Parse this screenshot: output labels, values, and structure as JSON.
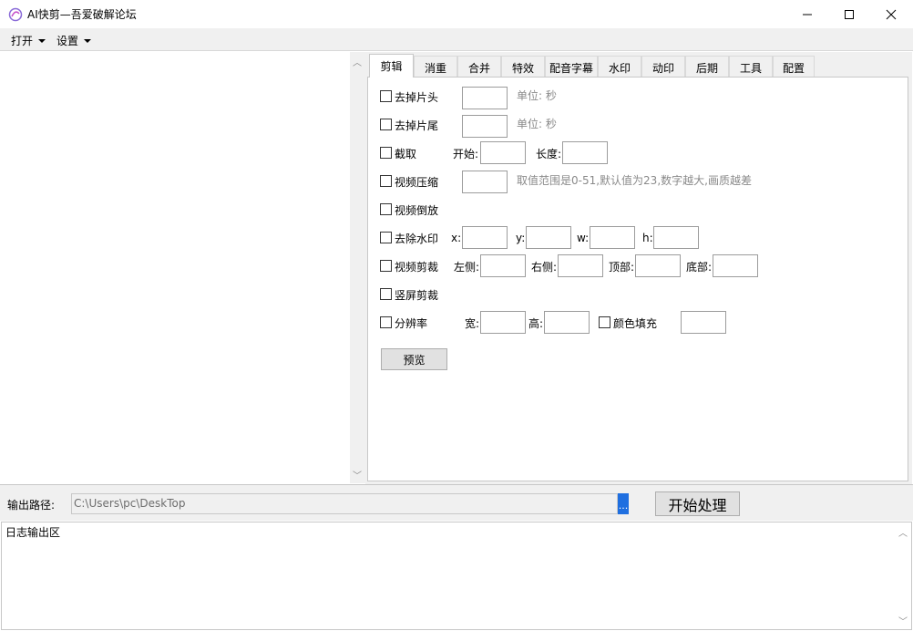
{
  "window": {
    "title": "AI快剪—吾爱破解论坛",
    "minimize_icon": "minimize-icon",
    "maximize_icon": "maximize-icon",
    "close_icon": "close-icon"
  },
  "menu": {
    "open_label": "打开",
    "settings_label": "设置"
  },
  "tabs": [
    {
      "label": "剪辑",
      "active": true
    },
    {
      "label": "消重"
    },
    {
      "label": "合并"
    },
    {
      "label": "特效"
    },
    {
      "label": "配音字幕"
    },
    {
      "label": "水印"
    },
    {
      "label": "动印"
    },
    {
      "label": "后期"
    },
    {
      "label": "工具"
    },
    {
      "label": "配置"
    }
  ],
  "edit": {
    "trim_head": {
      "label": "去掉片头",
      "value": "",
      "unit": "单位: 秒"
    },
    "trim_tail": {
      "label": "去掉片尾",
      "value": "",
      "unit": "单位: 秒"
    },
    "clip": {
      "label": "截取",
      "start_label": "开始:",
      "start_value": "",
      "length_label": "长度:",
      "length_value": ""
    },
    "compress": {
      "label": "视频压缩",
      "value": "",
      "hint": "取值范围是0-51,默认值为23,数字越大,画质越差"
    },
    "reverse": {
      "label": "视频倒放"
    },
    "remove_watermark": {
      "label": "去除水印",
      "x_label": "x:",
      "y_label": "y:",
      "w_label": "w:",
      "h_label": "h:"
    },
    "crop": {
      "label": "视频剪裁",
      "left_label": "左侧:",
      "right_label": "右侧:",
      "top_label": "顶部:",
      "bottom_label": "底部:"
    },
    "vertical_crop": {
      "label": "竖屏剪裁"
    },
    "resolution": {
      "label": "分辨率",
      "width_label": "宽:",
      "height_label": "高:",
      "color_fill_label": "颜色填充"
    },
    "preview_label": "预览"
  },
  "output": {
    "path_label": "输出路径:",
    "path_value": "C:\\Users\\pc\\DeskTop",
    "browse_label": "...",
    "start_label": "开始处理"
  },
  "log": {
    "text": "日志输出区"
  },
  "colors": {
    "accent": "#1f6fe0",
    "panel_bg": "#f0f0f0"
  }
}
